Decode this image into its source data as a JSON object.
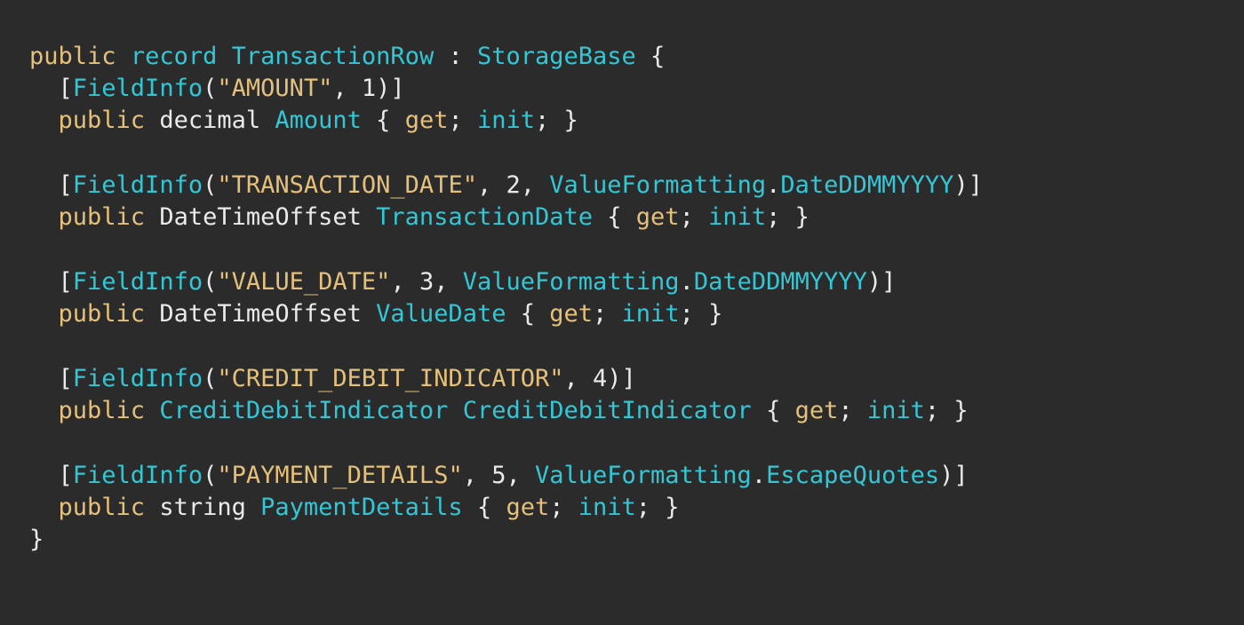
{
  "colors": {
    "background": "#2b2b2b",
    "keyword": "#e5c07b",
    "type": "#33c7d6",
    "string": "#e5c07b",
    "plain": "#eaeaea"
  },
  "code_lines": [
    [
      {
        "t": "public",
        "c": "kw"
      },
      {
        "t": " ",
        "c": "plain"
      },
      {
        "t": "record",
        "c": "kw2"
      },
      {
        "t": " ",
        "c": "plain"
      },
      {
        "t": "TransactionRow",
        "c": "type"
      },
      {
        "t": " : ",
        "c": "plain"
      },
      {
        "t": "StorageBase",
        "c": "type"
      },
      {
        "t": " {",
        "c": "plain"
      }
    ],
    [
      {
        "t": "  [",
        "c": "plain"
      },
      {
        "t": "FieldInfo",
        "c": "attr"
      },
      {
        "t": "(",
        "c": "plain"
      },
      {
        "t": "\"AMOUNT\"",
        "c": "str"
      },
      {
        "t": ", 1)]",
        "c": "plain"
      }
    ],
    [
      {
        "t": "  ",
        "c": "plain"
      },
      {
        "t": "public",
        "c": "kw"
      },
      {
        "t": " decimal ",
        "c": "plain"
      },
      {
        "t": "Amount",
        "c": "ident"
      },
      {
        "t": " { ",
        "c": "plain"
      },
      {
        "t": "get",
        "c": "kw"
      },
      {
        "t": "; ",
        "c": "plain"
      },
      {
        "t": "init",
        "c": "kw2"
      },
      {
        "t": "; }",
        "c": "plain"
      }
    ],
    [],
    [
      {
        "t": "  [",
        "c": "plain"
      },
      {
        "t": "FieldInfo",
        "c": "attr"
      },
      {
        "t": "(",
        "c": "plain"
      },
      {
        "t": "\"TRANSACTION_DATE\"",
        "c": "str"
      },
      {
        "t": ", 2, ",
        "c": "plain"
      },
      {
        "t": "ValueFormatting",
        "c": "type"
      },
      {
        "t": ".",
        "c": "plain"
      },
      {
        "t": "DateDDMMYYYY",
        "c": "type"
      },
      {
        "t": ")]",
        "c": "plain"
      }
    ],
    [
      {
        "t": "  ",
        "c": "plain"
      },
      {
        "t": "public",
        "c": "kw"
      },
      {
        "t": " DateTimeOffset ",
        "c": "plain"
      },
      {
        "t": "TransactionDate",
        "c": "ident"
      },
      {
        "t": " { ",
        "c": "plain"
      },
      {
        "t": "get",
        "c": "kw"
      },
      {
        "t": "; ",
        "c": "plain"
      },
      {
        "t": "init",
        "c": "kw2"
      },
      {
        "t": "; }",
        "c": "plain"
      }
    ],
    [],
    [
      {
        "t": "  [",
        "c": "plain"
      },
      {
        "t": "FieldInfo",
        "c": "attr"
      },
      {
        "t": "(",
        "c": "plain"
      },
      {
        "t": "\"VALUE_DATE\"",
        "c": "str"
      },
      {
        "t": ", 3, ",
        "c": "plain"
      },
      {
        "t": "ValueFormatting",
        "c": "type"
      },
      {
        "t": ".",
        "c": "plain"
      },
      {
        "t": "DateDDMMYYYY",
        "c": "type"
      },
      {
        "t": ")]",
        "c": "plain"
      }
    ],
    [
      {
        "t": "  ",
        "c": "plain"
      },
      {
        "t": "public",
        "c": "kw"
      },
      {
        "t": " DateTimeOffset ",
        "c": "plain"
      },
      {
        "t": "ValueDate",
        "c": "ident"
      },
      {
        "t": " { ",
        "c": "plain"
      },
      {
        "t": "get",
        "c": "kw"
      },
      {
        "t": "; ",
        "c": "plain"
      },
      {
        "t": "init",
        "c": "kw2"
      },
      {
        "t": "; }",
        "c": "plain"
      }
    ],
    [],
    [
      {
        "t": "  [",
        "c": "plain"
      },
      {
        "t": "FieldInfo",
        "c": "attr"
      },
      {
        "t": "(",
        "c": "plain"
      },
      {
        "t": "\"CREDIT_DEBIT_INDICATOR\"",
        "c": "str"
      },
      {
        "t": ", 4)]",
        "c": "plain"
      }
    ],
    [
      {
        "t": "  ",
        "c": "plain"
      },
      {
        "t": "public",
        "c": "kw"
      },
      {
        "t": " ",
        "c": "plain"
      },
      {
        "t": "CreditDebitIndicator",
        "c": "type"
      },
      {
        "t": " ",
        "c": "plain"
      },
      {
        "t": "CreditDebitIndicator",
        "c": "ident"
      },
      {
        "t": " { ",
        "c": "plain"
      },
      {
        "t": "get",
        "c": "kw"
      },
      {
        "t": "; ",
        "c": "plain"
      },
      {
        "t": "init",
        "c": "kw2"
      },
      {
        "t": "; }",
        "c": "plain"
      }
    ],
    [],
    [
      {
        "t": "  [",
        "c": "plain"
      },
      {
        "t": "FieldInfo",
        "c": "attr"
      },
      {
        "t": "(",
        "c": "plain"
      },
      {
        "t": "\"PAYMENT_DETAILS\"",
        "c": "str"
      },
      {
        "t": ", 5, ",
        "c": "plain"
      },
      {
        "t": "ValueFormatting",
        "c": "type"
      },
      {
        "t": ".",
        "c": "plain"
      },
      {
        "t": "EscapeQuotes",
        "c": "type"
      },
      {
        "t": ")]",
        "c": "plain"
      }
    ],
    [
      {
        "t": "  ",
        "c": "plain"
      },
      {
        "t": "public",
        "c": "kw"
      },
      {
        "t": " string ",
        "c": "plain"
      },
      {
        "t": "PaymentDetails",
        "c": "ident"
      },
      {
        "t": " { ",
        "c": "plain"
      },
      {
        "t": "get",
        "c": "kw"
      },
      {
        "t": "; ",
        "c": "plain"
      },
      {
        "t": "init",
        "c": "kw2"
      },
      {
        "t": "; }",
        "c": "plain"
      }
    ],
    [
      {
        "t": "}",
        "c": "plain"
      }
    ]
  ]
}
